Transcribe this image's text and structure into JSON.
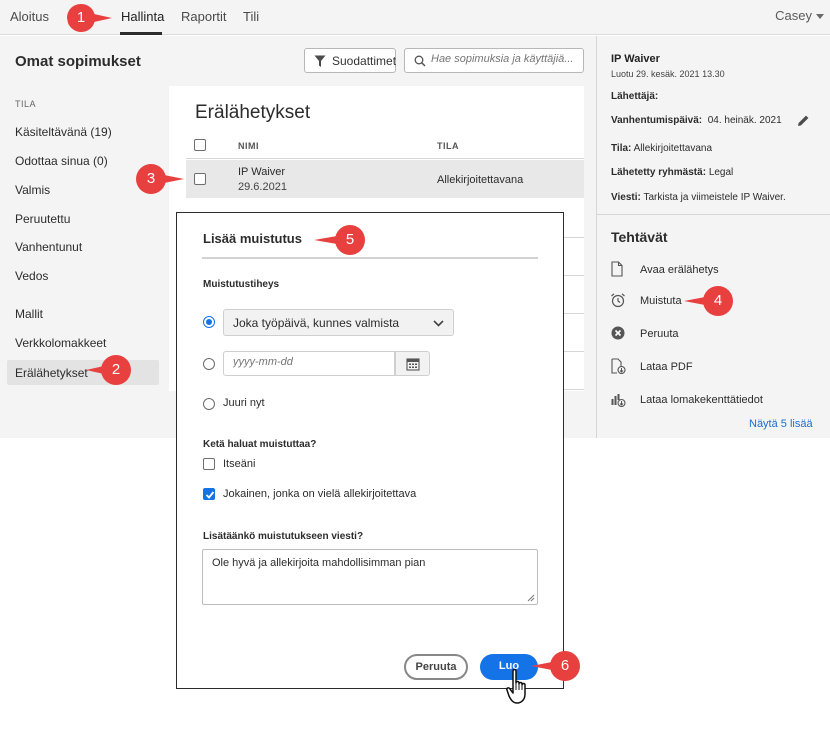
{
  "topnav": {
    "tabs": [
      {
        "label": "Aloitus"
      },
      {
        "label": "Hallinta"
      },
      {
        "label": "Raportit"
      },
      {
        "label": "Tili"
      }
    ],
    "user": "Casey"
  },
  "header": {
    "title": "Omat sopimukset",
    "filter_label": "Suodattimet",
    "search_placeholder": "Hae sopimuksia ja käyttäjiä..."
  },
  "sidebar": {
    "heading": "TILA",
    "items": [
      {
        "label": "Käsiteltävänä (19)"
      },
      {
        "label": "Odottaa sinua (0)"
      },
      {
        "label": "Valmis"
      },
      {
        "label": "Peruutettu"
      },
      {
        "label": "Vanhentunut"
      },
      {
        "label": "Vedos"
      },
      {
        "label": "Mallit"
      },
      {
        "label": "Verkkolomakkeet"
      },
      {
        "label": "Erälähetykset"
      }
    ]
  },
  "main": {
    "title": "Erälähetykset",
    "columns": [
      "NIMI",
      "TILA"
    ],
    "rows": [
      {
        "name": "IP Waiver",
        "date": "29.6.2021",
        "status": "Allekirjoitettavana"
      }
    ]
  },
  "details": {
    "title": "IP Waiver",
    "created": "Luotu 29. kesäk. 2021 13.30",
    "sender_label": "Lähettäjä:",
    "expiry_label": "Vanhentumispäivä:",
    "expiry_value": "04. heinäk. 2021",
    "status_label": "Tila:",
    "status_value": "Allekirjoitettavana",
    "group_label": "Lähetetty ryhmästä:",
    "group_value": "Legal",
    "message_label": "Viesti:",
    "message_value": "Tarkista ja viimeistele IP Waiver.",
    "tasks_heading": "Tehtävät",
    "tasks": [
      {
        "label": "Avaa erälähetys",
        "icon": "document-icon"
      },
      {
        "label": "Muistuta",
        "icon": "alarm-clock-icon"
      },
      {
        "label": "Peruuta",
        "icon": "cancel-circle-icon"
      },
      {
        "label": "Lataa PDF",
        "icon": "pdf-download-icon"
      },
      {
        "label": "Lataa lomakekenttätiedot",
        "icon": "data-download-icon"
      }
    ],
    "more_link": "Näytä 5 lisää"
  },
  "modal": {
    "title": "Lisää muistutus",
    "frequency_label": "Muistutustiheys",
    "frequency_selected": "Joka työpäivä, kunnes valmista",
    "date_placeholder": "yyyy-mm-dd",
    "now_label": "Juuri nyt",
    "who_label": "Ketä haluat muistuttaa?",
    "who_options": [
      {
        "label": "Itseäni",
        "checked": false
      },
      {
        "label": "Jokainen, jonka on vielä allekirjoitettava",
        "checked": true
      }
    ],
    "message_label": "Lisätäänkö muistutukseen viesti?",
    "message_value": "Ole hyvä ja allekirjoita mahdollisimman pian",
    "cancel_label": "Peruuta",
    "create_label": "Luo"
  },
  "callouts": [
    "1",
    "2",
    "3",
    "4",
    "5",
    "6"
  ],
  "colors": {
    "accent": "#1473e6",
    "callout": "#e8403f",
    "link": "#1a6fd1"
  }
}
